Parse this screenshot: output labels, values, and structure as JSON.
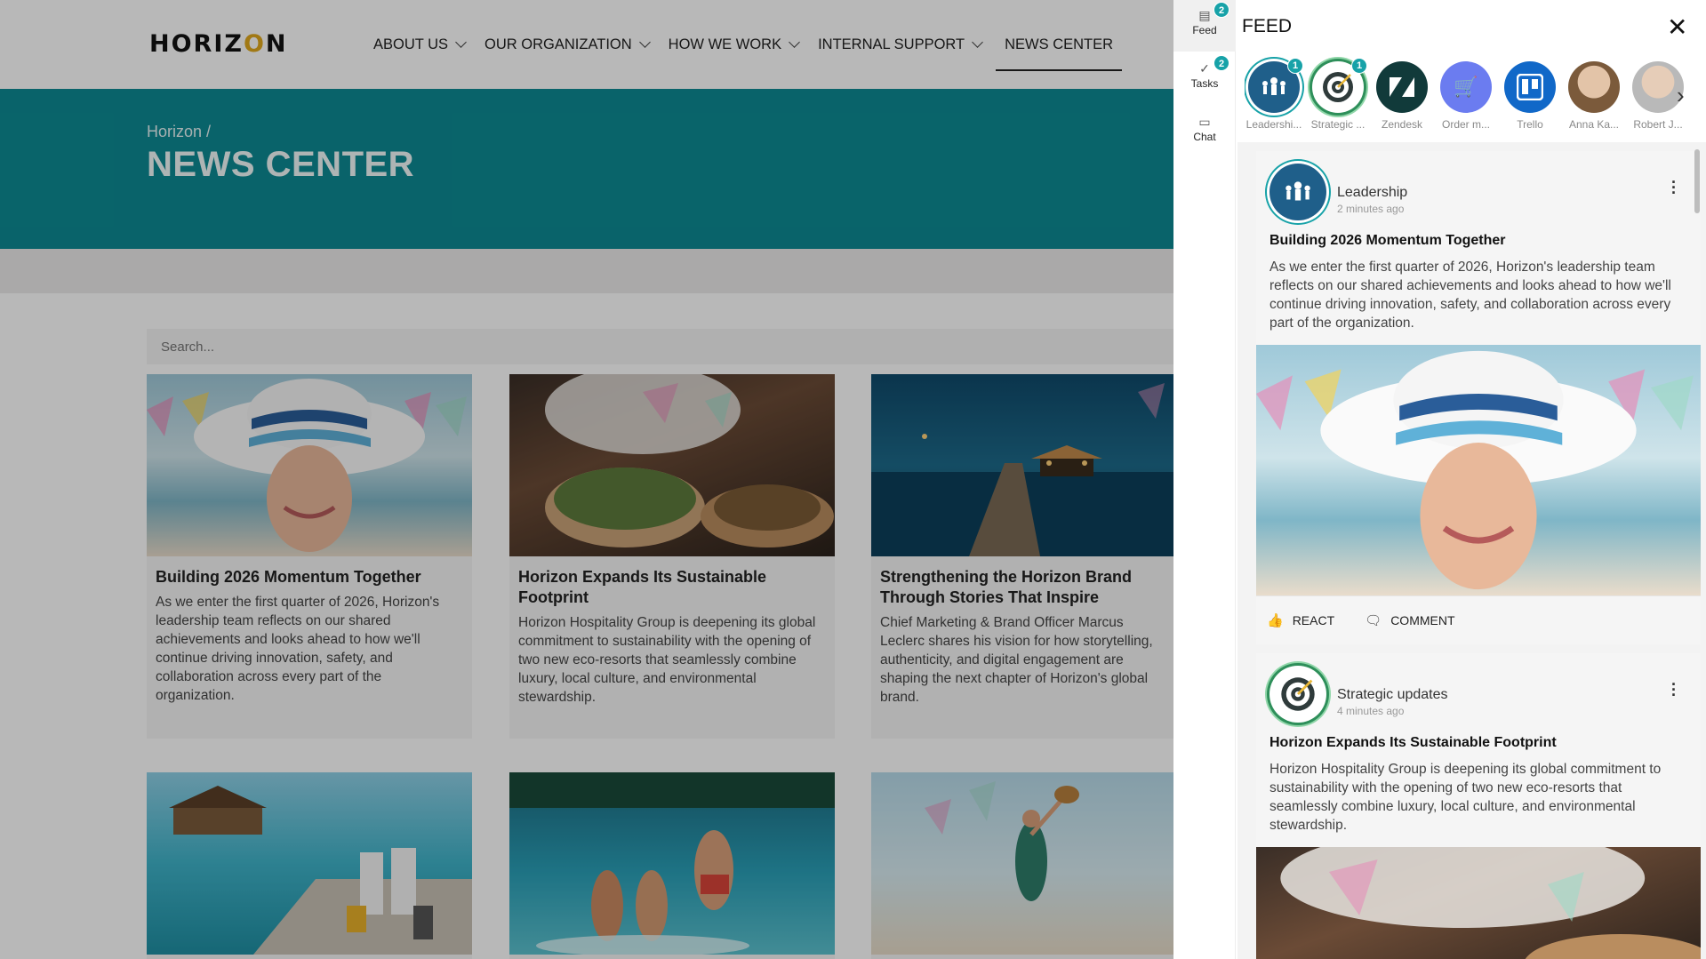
{
  "site": {
    "logo": "HORIZON",
    "nav": [
      {
        "label": "ABOUT US",
        "dropdown": true
      },
      {
        "label": "OUR ORGANIZATION",
        "dropdown": true
      },
      {
        "label": "HOW WE WORK",
        "dropdown": true
      },
      {
        "label": "INTERNAL SUPPORT",
        "dropdown": true
      },
      {
        "label": "NEWS CENTER",
        "dropdown": false,
        "active": true
      }
    ],
    "breadcrumb": "Horizon /",
    "page_title": "NEWS CENTER",
    "search_placeholder": "Search...",
    "accent_color": "#0d8a93",
    "cards": [
      {
        "title": "Building 2026 Momentum Together",
        "text": "As we enter the first quarter of 2026, Horizon's leadership team reflects on our shared achievements and looks ahead to how we'll continue driving innovation, safety, and collaboration across every part of the organization.",
        "image": "woman-sun-hat-beach"
      },
      {
        "title": "Horizon Expands Its Sustainable Footprint",
        "text": "Horizon Hospitality Group is deepening its global commitment to sustainability with the opening of two new eco-resorts that seamlessly combine luxury, local culture, and environmental stewardship.",
        "image": "chef-plating-food"
      },
      {
        "title": "Strengthening the Horizon Brand Through Stories That Inspire",
        "text": "Chief Marketing & Brand Officer Marcus Leclerc shares his vision for how storytelling, authenticity, and digital engagement are shaping the next chapter of Horizon's global brand.",
        "image": "pier-at-dusk"
      },
      {
        "title": "",
        "text": "",
        "image": "couple-on-dock-with-luggage"
      },
      {
        "title": "",
        "text": "",
        "image": "kids-jumping-into-sea"
      },
      {
        "title": "",
        "text": "",
        "image": "woman-jumping-on-beach"
      }
    ]
  },
  "panel": {
    "title": "FEED",
    "rail": [
      {
        "label": "Feed",
        "icon": "feed-icon",
        "badge": "2",
        "active": true
      },
      {
        "label": "Tasks",
        "icon": "check-icon",
        "badge": "2",
        "active": false
      },
      {
        "label": "Chat",
        "icon": "chat-icon",
        "badge": "",
        "active": false
      }
    ],
    "stories": [
      {
        "label": "Leadershi...",
        "badge": "1",
        "color": "#1f5f8a",
        "icon": "leadership-icon"
      },
      {
        "label": "Strategic ...",
        "badge": "1",
        "color": "#2e8f5a",
        "icon": "target-icon"
      },
      {
        "label": "Zendesk",
        "badge": "",
        "color": "#113a3a",
        "icon": "zendesk-icon"
      },
      {
        "label": "Order m...",
        "badge": "",
        "color": "#6b7cf0",
        "icon": "cart-icon"
      },
      {
        "label": "Trello",
        "badge": "",
        "color": "#1168c8",
        "icon": "trello-icon"
      },
      {
        "label": "Anna Ka...",
        "badge": "",
        "color": "#c9a98c",
        "icon": "avatar"
      },
      {
        "label": "Robert J...",
        "badge": "",
        "color": "#9a9a9a",
        "icon": "avatar"
      }
    ],
    "posts": [
      {
        "author": "Leadership",
        "time": "2 minutes ago",
        "title": "Building 2026 Momentum Together",
        "text": "As we enter the first quarter of 2026, Horizon's leadership team reflects on our shared achievements and looks ahead to how we'll continue driving innovation, safety, and collaboration across every part of the organization.",
        "react": "REACT",
        "comment": "COMMENT"
      },
      {
        "author": "Strategic updates",
        "time": "4 minutes ago",
        "title": "Horizon Expands Its Sustainable Footprint",
        "text": "Horizon Hospitality Group is deepening its global commitment to sustainability with the opening of two new eco-resorts that seamlessly combine luxury, local culture, and environmental stewardship."
      }
    ]
  }
}
